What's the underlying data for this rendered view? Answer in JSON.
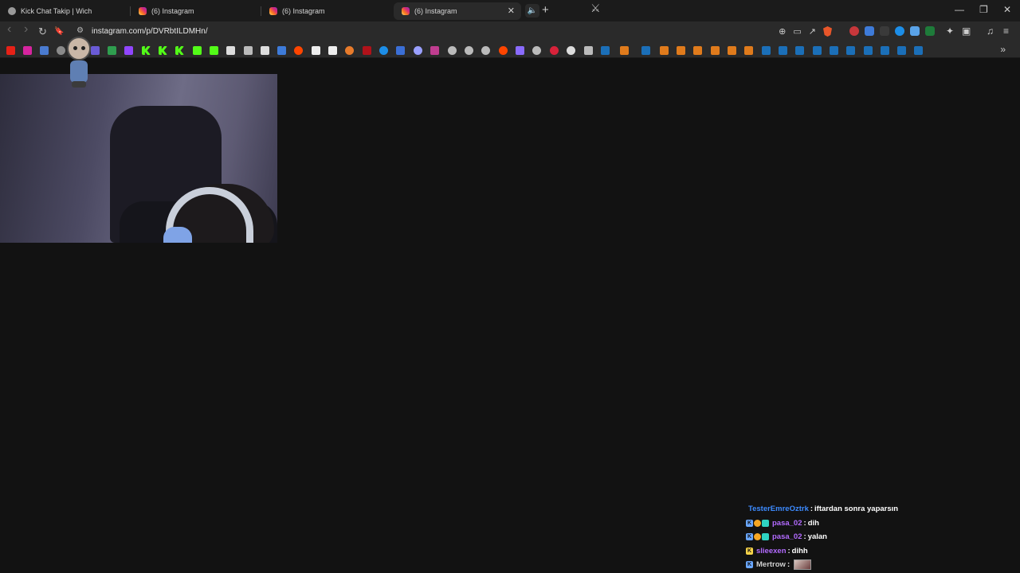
{
  "tabs": [
    {
      "title": "Kick Chat Takip | Wich",
      "favicon": "globe-icon"
    },
    {
      "title": "(6) Instagram",
      "favicon": "instagram-icon"
    },
    {
      "title": "(6) Instagram",
      "favicon": "instagram-icon"
    },
    {
      "title": "(6) Instagram",
      "favicon": "instagram-icon",
      "active": true
    }
  ],
  "tab_controls": {
    "close": "✕",
    "new_tab": "+",
    "audio": "🔈"
  },
  "window_controls": {
    "minimize": "—",
    "restore": "❐",
    "close": "✕"
  },
  "toolbar": {
    "back": "‹",
    "forward": "›",
    "reload": "↻",
    "bookmark": "🔖",
    "site_info": "⚙",
    "url": "instagram.com/p/DVRbtILDMHn/",
    "zoom": "⊕",
    "cast": "▭",
    "share": "↗",
    "extensions": "✦",
    "side_panel": "▣",
    "media": "♫",
    "menu": "≡"
  },
  "bookmarks_more": "»",
  "chat": [
    {
      "user": "TesterEmreOztrk",
      "user_color": "#3d8bff",
      "badges": [],
      "message": "iftardan sonra yaparsın"
    },
    {
      "user": "pasa_02",
      "user_color": "#b36bff",
      "badges": [
        "kick-blue",
        "coin",
        "gift"
      ],
      "message": "dih"
    },
    {
      "user": "pasa_02",
      "user_color": "#b36bff",
      "badges": [
        "kick-blue",
        "coin",
        "gift"
      ],
      "message": "yalan"
    },
    {
      "user": "slieexen",
      "user_color": "#b36bff",
      "badges": [
        "kick-yellow"
      ],
      "message": "dihh"
    },
    {
      "user": "Mertrow",
      "user_color": "#d0d0d0",
      "badges": [
        "kick-blue"
      ],
      "message": "",
      "emote": true
    }
  ],
  "colors": {
    "page_bg": "#121212",
    "tabstrip_bg": "#1b1b1b",
    "toolbar_bg": "#2a2a2a",
    "kick_green": "#53fc18"
  }
}
